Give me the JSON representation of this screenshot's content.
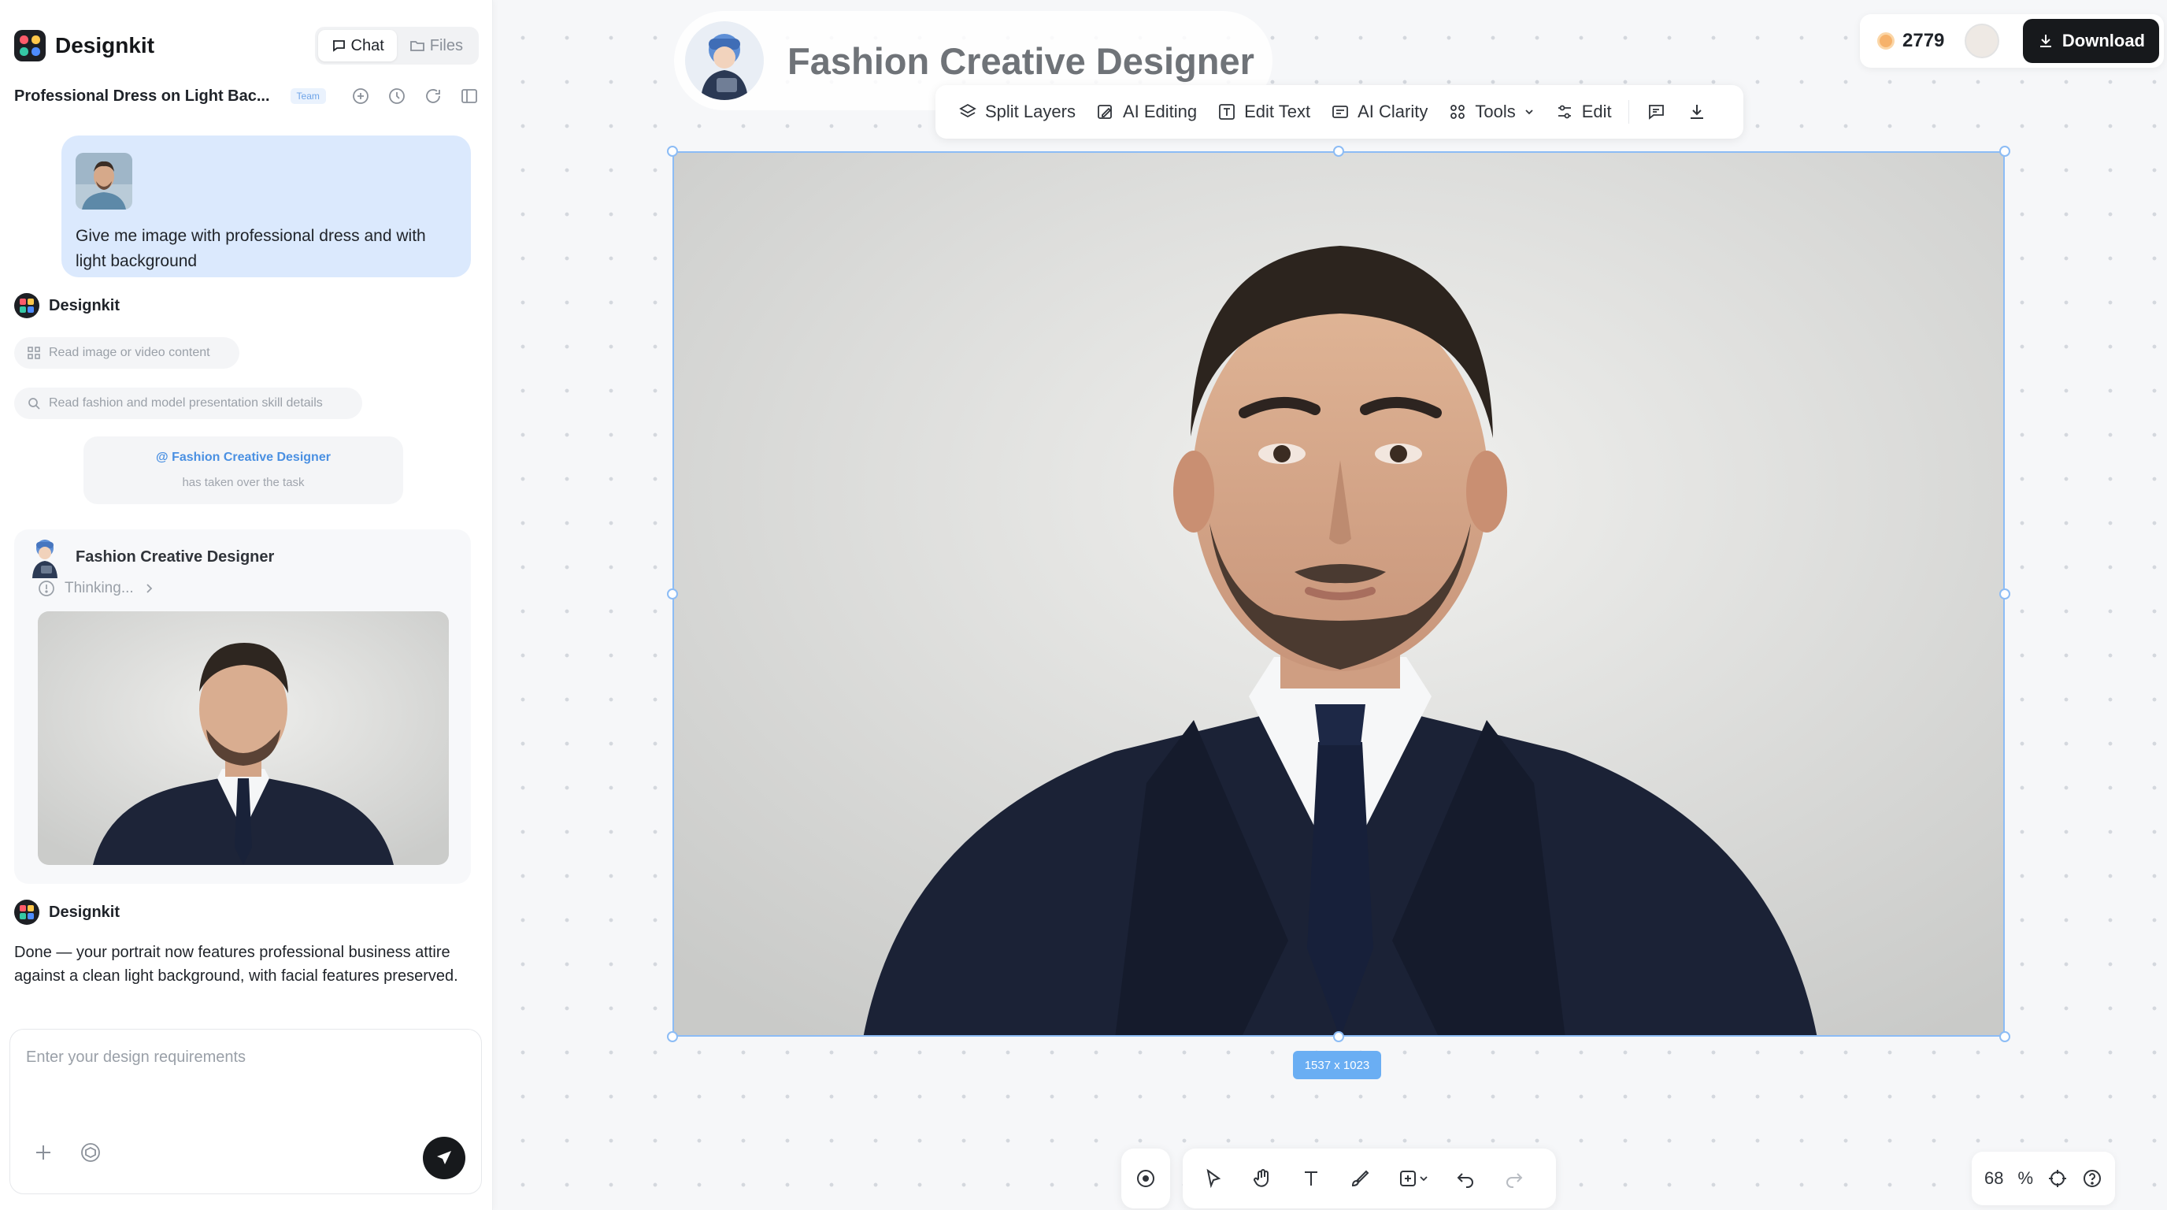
{
  "app": {
    "brand": "Designkit"
  },
  "sidebar": {
    "tabs": [
      {
        "label": "Chat",
        "active": true
      },
      {
        "label": "Files",
        "active": false
      }
    ],
    "project_title": "Professional Dress on Light Bac...",
    "project_tag": "Team",
    "messages": {
      "user_prompt": "Give me image with professional dress and with light background",
      "agent_name": "Designkit",
      "steps": [
        "Read image or video content",
        "Read fashion and model presentation skill details"
      ],
      "handoff_agent": "@ Fashion Creative Designer",
      "handoff_note": "has taken over the task",
      "designer_name": "Fashion Creative Designer",
      "thinking_label": "Thinking...",
      "final_agent_name": "Designkit",
      "final_message": "Done — your portrait now features professional business attire against a clean light background, with facial features preserved."
    },
    "composer": {
      "placeholder": "Enter your design requirements"
    }
  },
  "canvas": {
    "agent_title": "Fashion Creative Designer",
    "credits": "2779",
    "download_label": "Download",
    "toolbar": [
      {
        "label": "Split Layers",
        "icon": "layers-icon"
      },
      {
        "label": "AI Editing",
        "icon": "ai-edit-icon"
      },
      {
        "label": "Edit Text",
        "icon": "text-box-icon"
      },
      {
        "label": "AI Clarity",
        "icon": "clarity-icon"
      },
      {
        "label": "Tools",
        "icon": "grid-icon"
      },
      {
        "label": "Edit",
        "icon": "sliders-icon"
      }
    ],
    "image_dimensions": "1537 x 1023",
    "zoom": {
      "value": "68",
      "unit": "%"
    }
  },
  "colors": {
    "accent_blue": "#4a90e2",
    "selection_border": "#8cbcf5",
    "user_bubble": "#dbe9fd",
    "dark_button": "#17191c"
  }
}
